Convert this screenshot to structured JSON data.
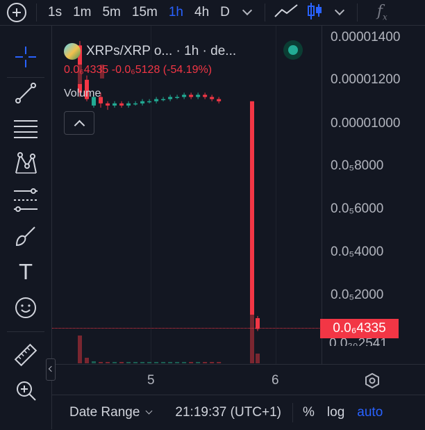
{
  "toolbar": {
    "timeframes": [
      "1s",
      "1m",
      "5m",
      "15m",
      "1h",
      "4h",
      "D"
    ],
    "active_timeframe": "1h",
    "fx_label": "f",
    "fx_sub": "x"
  },
  "legend": {
    "symbol": "XRPs/XRP o... · 1h · de...",
    "ohlc": "0.0₆4335  -0.0₆5128 (-54.19%)",
    "volume_label": "Volume"
  },
  "price_scale": {
    "labels": [
      "0.00001400",
      "0.00001200",
      "0.00001000",
      "0.0₅8000",
      "0.0₅6000",
      "0.0₅4000",
      "0.0₅2000"
    ],
    "current_price": "0.0₆4335",
    "partial_label": "0.0₂₀2541"
  },
  "time_axis": {
    "labels": [
      "5",
      "6"
    ]
  },
  "bottom_bar": {
    "date_range": "Date Range",
    "clock": "21:19:37 (UTC+1)",
    "percent": "%",
    "log": "log",
    "auto": "auto"
  },
  "colors": {
    "background": "#131722",
    "up": "#22ab94",
    "down": "#f23645",
    "accent": "#2962ff"
  },
  "chart_data": {
    "type": "candlestick",
    "y_axis_labels": [
      "0.00001400",
      "0.00001200",
      "0.00001000",
      "0.0₅8000",
      "0.0₅6000",
      "0.0₅4000",
      "0.0₅2000"
    ],
    "x_axis_labels": [
      "5",
      "6"
    ],
    "last_price": 4.335e-07,
    "change": -5.128e-07,
    "change_percent": -54.19,
    "note_candles": [
      {
        "open": 1.36e-05,
        "close": 1.14e-05,
        "high": 1.38e-05,
        "low": 1.12e-05
      },
      {
        "open": 1.2e-05,
        "close": 1.11e-05,
        "high": 1.22e-05,
        "low": 1.1e-05
      },
      {
        "open": 1.08e-05,
        "close": 1.12e-05,
        "high": 1.13e-05,
        "low": 1.07e-05
      },
      {
        "open": 1.12e-05,
        "close": 1.09e-05,
        "high": 1.14e-05,
        "low": 1.07e-05
      },
      {
        "open": 1.09e-05,
        "close": 1.08e-05,
        "high": 1.1e-05,
        "low": 1.06e-05
      },
      {
        "open": 1.08e-05,
        "close": 1.09e-05,
        "high": 1.1e-05,
        "low": 1.07e-05
      },
      {
        "open": 1.09e-05,
        "close": 1.08e-05,
        "high": 1.1e-05,
        "low": 1.07e-05
      },
      {
        "open": 1.08e-05,
        "close": 1.09e-05,
        "high": 1.1e-05,
        "low": 1.07e-05
      },
      {
        "open": 1.09e-05,
        "close": 1.09e-05,
        "high": 1.1e-05,
        "low": 1.08e-05
      },
      {
        "open": 1.09e-05,
        "close": 1.1e-05,
        "high": 1.11e-05,
        "low": 1.08e-05
      },
      {
        "open": 1.1e-05,
        "close": 1.1e-05,
        "high": 1.11e-05,
        "low": 1.09e-05
      },
      {
        "open": 1.1e-05,
        "close": 1.11e-05,
        "high": 1.12e-05,
        "low": 1.09e-05
      },
      {
        "open": 1.11e-05,
        "close": 1.11e-05,
        "high": 1.12e-05,
        "low": 1.1e-05
      },
      {
        "open": 1.11e-05,
        "close": 1.12e-05,
        "high": 1.13e-05,
        "low": 1.1e-05
      },
      {
        "open": 1.12e-05,
        "close": 1.12e-05,
        "high": 1.13e-05,
        "low": 1.11e-05
      },
      {
        "open": 1.12e-05,
        "close": 1.13e-05,
        "high": 1.14e-05,
        "low": 1.11e-05
      },
      {
        "open": 1.13e-05,
        "close": 1.12e-05,
        "high": 1.14e-05,
        "low": 1.11e-05
      },
      {
        "open": 1.12e-05,
        "close": 1.13e-05,
        "high": 1.14e-05,
        "low": 1.11e-05
      },
      {
        "open": 1.13e-05,
        "close": 1.12e-05,
        "high": 1.14e-05,
        "low": 1.11e-05
      },
      {
        "open": 1.12e-05,
        "close": 1.11e-05,
        "high": 1.13e-05,
        "low": 1.1e-05
      },
      {
        "open": 1.11e-05,
        "close": 1.1e-05,
        "high": 1.12e-05,
        "low": 1.09e-05
      },
      {
        "open": 1.1e-05,
        "close": 9e-07,
        "high": 1.1e-05,
        "low": 3e-07
      },
      {
        "open": 9e-07,
        "close": 4e-07,
        "high": 1e-06,
        "low": 3e-07
      }
    ]
  }
}
